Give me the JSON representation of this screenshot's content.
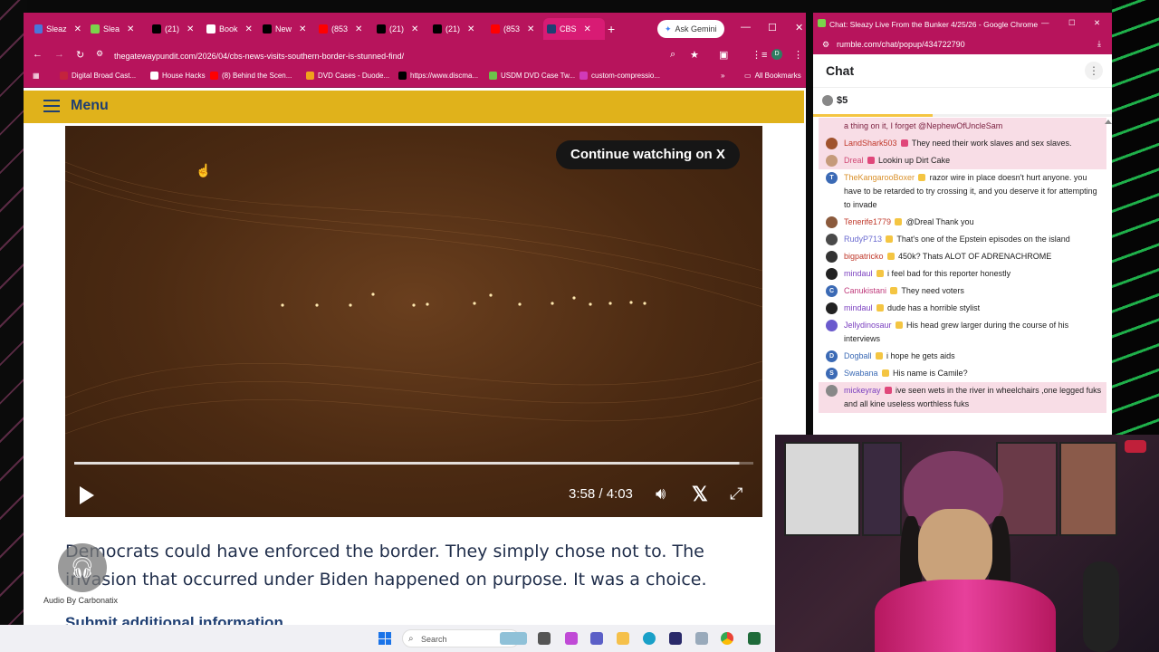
{
  "browser_main": {
    "tabs": [
      {
        "label": "Sleaz",
        "icon": "rumble-r-icon",
        "color": "#4a76d9"
      },
      {
        "label": "Slea",
        "icon": "rumble-play-icon",
        "color": "#7bd34b"
      },
      {
        "label": "(21)",
        "icon": "x-icon",
        "color": "#000000"
      },
      {
        "label": "Book",
        "icon": "star-icon",
        "color": "#ffffff"
      },
      {
        "label": "New",
        "icon": "github-icon",
        "color": "#000000"
      },
      {
        "label": "(853",
        "icon": "youtube-icon",
        "color": "#ff0000"
      },
      {
        "label": "(21)",
        "icon": "x-icon",
        "color": "#000000"
      },
      {
        "label": "(21)",
        "icon": "x-icon",
        "color": "#000000"
      },
      {
        "label": "(853",
        "icon": "youtube-icon",
        "color": "#ff0000"
      },
      {
        "label": "CBS",
        "icon": "gp-icon",
        "color": "#1f3f73",
        "active": true
      }
    ],
    "ask_gemini": "Ask Gemini",
    "url": "thegatewaypundit.com/2026/04/cbs-news-visits-southern-border-is-stunned-find/",
    "bookmarks": [
      {
        "label": "Digital Broad Cast...",
        "color": "#c4233d"
      },
      {
        "label": "House Hacks",
        "color": "#ffffff"
      },
      {
        "label": "(8) Behind the Scen...",
        "color": "#ff0000"
      },
      {
        "label": "DVD Cases - Duode...",
        "color": "#f0a21c"
      },
      {
        "label": "https://www.discma...",
        "color": "#000000"
      },
      {
        "label": "USDM DVD Case Tw...",
        "color": "#6cc24a"
      },
      {
        "label": "custom-compressio...",
        "color": "#d13ab8"
      }
    ],
    "all_bookmarks": "All Bookmarks"
  },
  "site": {
    "menu_label": "Menu",
    "video": {
      "continue_label": "Continue watching on X",
      "time": "3:58 / 4:03",
      "progress": 0.979
    },
    "article_lines": [
      "Democrats could have enforced the border. They simply chose not to. The",
      "invasion that occurred under Biden happened on purpose. It was a choice."
    ],
    "audio_by": "Audio By Carbonatix",
    "submit_label": "Submit additional information"
  },
  "chat_window": {
    "title": "Chat: Sleazy Live From the Bunker 4/25/26 - Google Chrome",
    "url": "rumble.com/chat/popup/434722790",
    "header": "Chat",
    "rant_amount": "$5",
    "messages": [
      {
        "user": "",
        "text": "a thing on it, I forget @NephewOfUncleSam",
        "color": "#7a1f3f",
        "avatar": "",
        "avatar_color": "#ffffff",
        "highlight": true
      },
      {
        "user": "LandShark503",
        "text": "They need their work slaves and sex slaves.",
        "color": "#c0392b",
        "avatar": "",
        "avatar_color": "#a0522d",
        "highlight": true
      },
      {
        "user": "Dreal",
        "text": "Lookin up Dirt Cake",
        "color": "#d04a76",
        "avatar": "",
        "avatar_color": "#c59a7a",
        "highlight": true
      },
      {
        "user": "TheKangarooBoxer",
        "text": "razor wire in place doesn't hurt anyone. you have to be retarded to try crossing it, and you deserve it for attempting to invade",
        "color": "#d9902a",
        "avatar": "T",
        "avatar_color": "#3b6ab5",
        "highlight": false
      },
      {
        "user": "Tenerife1779",
        "text": "@Dreal Thank you",
        "color": "#c0392b",
        "avatar": "",
        "avatar_color": "#8b5a3c",
        "highlight": false
      },
      {
        "user": "RudyP713",
        "text": "That's one of the Epstein episodes on the island",
        "color": "#6b6bd0",
        "avatar": "",
        "avatar_color": "#4a4a4a",
        "highlight": false
      },
      {
        "user": "bigpatricko",
        "text": "450k? Thats ALOT OF ADRENACHROME",
        "color": "#c0392b",
        "avatar": "",
        "avatar_color": "#333333",
        "highlight": false
      },
      {
        "user": "mindaul",
        "text": "i feel bad for this reporter honestly",
        "color": "#7a3fbf",
        "avatar": "",
        "avatar_color": "#222222",
        "highlight": false
      },
      {
        "user": "Canukistani",
        "text": "They need voters",
        "color": "#c03c7c",
        "avatar": "C",
        "avatar_color": "#3b6ab5",
        "highlight": false
      },
      {
        "user": "mindaul",
        "text": "dude has a horrible stylist",
        "color": "#7a3fbf",
        "avatar": "",
        "avatar_color": "#222222",
        "highlight": false
      },
      {
        "user": "Jellydinosaur",
        "text": "His head grew larger during the course of his interviews",
        "color": "#7a3fbf",
        "avatar": "",
        "avatar_color": "#6a5acd",
        "highlight": false
      },
      {
        "user": "Dogball",
        "text": "i hope he gets aids",
        "color": "#3b6ab5",
        "avatar": "D",
        "avatar_color": "#3b6ab5",
        "highlight": false
      },
      {
        "user": "Swabana",
        "text": "His name is Camile?",
        "color": "#3b6ab5",
        "avatar": "S",
        "avatar_color": "#3b6ab5",
        "highlight": false
      },
      {
        "user": "mickeyray",
        "text": "ive seen wets in the river in wheelchairs ,one legged fuks and all kine useless worthless fuks",
        "color": "#7a3fbf",
        "avatar": "",
        "avatar_color": "#888888",
        "highlight": true
      }
    ]
  },
  "taskbar": {
    "search_label": "Search"
  },
  "colors": {
    "browser_chrome": "#b7145c",
    "menu_bar": "#e0b21b",
    "site_navy": "#1f3f73"
  }
}
